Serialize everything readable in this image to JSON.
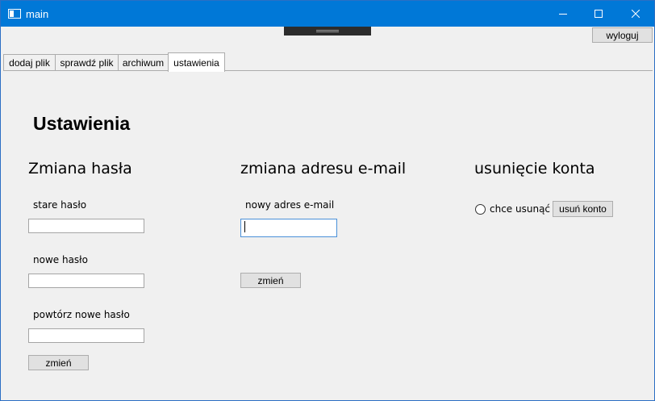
{
  "window": {
    "title": "main",
    "icon": "app-window-icon"
  },
  "header": {
    "logout_label": "wyloguj"
  },
  "tabs": [
    {
      "label": "dodaj plik",
      "active": false
    },
    {
      "label": "sprawdź plik",
      "active": false
    },
    {
      "label": "archiwum",
      "active": false
    },
    {
      "label": "ustawienia",
      "active": true
    }
  ],
  "settings": {
    "title": "Ustawienia",
    "password": {
      "heading": "Zmiana hasła",
      "old_label": "stare hasło",
      "old_value": "",
      "new_label": "nowe hasło",
      "new_value": "",
      "repeat_label": "powtórz nowe hasło",
      "repeat_value": "",
      "submit_label": "zmień"
    },
    "email": {
      "heading": "zmiana adresu e-mail",
      "new_label": "nowy adres e-mail",
      "new_value": "",
      "submit_label": "zmień"
    },
    "delete": {
      "heading": "usunięcie konta",
      "radio_label": "chce usunąć",
      "radio_checked": false,
      "button_label": "usuń konto"
    }
  },
  "colors": {
    "titlebar": "#0078d7",
    "background": "#f0f0f0",
    "focus_border": "#4a90d9"
  }
}
